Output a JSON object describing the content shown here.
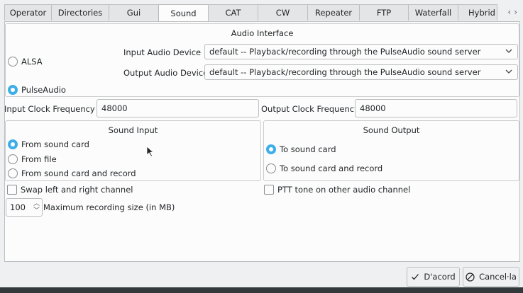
{
  "tabs": [
    {
      "label": "Operator",
      "width": 67
    },
    {
      "label": "Directories",
      "width": 82
    },
    {
      "label": "Gui",
      "width": 71
    },
    {
      "label": "Sound",
      "width": 71,
      "active": true
    },
    {
      "label": "CAT",
      "width": 71
    },
    {
      "label": "CW",
      "width": 71
    },
    {
      "label": "Repeater",
      "width": 74
    },
    {
      "label": "FTP",
      "width": 70
    },
    {
      "label": "Waterfall",
      "width": 71
    },
    {
      "label": "Hybrid",
      "width": 56
    }
  ],
  "tab_scroll": {
    "left": "‹",
    "right": "›"
  },
  "audio_interface": {
    "title": "Audio Interface",
    "alsa_label": "ALSA",
    "pulse_label": "PulseAudio",
    "input_device_label": "Input Audio Device",
    "input_device_value": "default -- Playback/recording through the PulseAudio sound server",
    "output_device_label": "Output Audio Device",
    "output_device_value": "default -- Playback/recording through the PulseAudio sound server",
    "selected": "PulseAudio"
  },
  "clock": {
    "input_label": "Input  Clock Frequency",
    "input_value": "48000",
    "output_label": "Output Clock Frequency",
    "output_value": "48000"
  },
  "sound_input": {
    "title": "Sound Input",
    "options": [
      "From sound card",
      "From file",
      "From sound card and record"
    ],
    "selected": "From sound card"
  },
  "sound_output": {
    "title": "Sound Output",
    "options": [
      "To sound card",
      "To sound card and record"
    ],
    "selected": "To sound card"
  },
  "swap_channel_label": "Swap left and right channel",
  "ptt_tone_label": "PTT tone on other audio channel",
  "max_recording": {
    "value": "100",
    "label": "Maximum recording size (in MB)"
  },
  "buttons": {
    "ok": "D'acord",
    "cancel": "Cancel·la"
  },
  "colors": {
    "accent": "#3daee9",
    "background": "#eff0f1"
  }
}
